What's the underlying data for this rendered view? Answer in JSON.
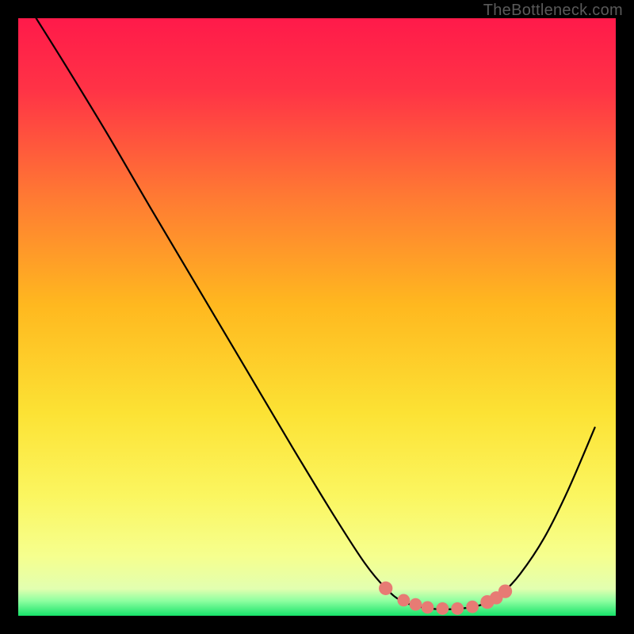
{
  "watermark": "TheBottleneck.com",
  "chart_data": {
    "type": "line",
    "title": "",
    "xlabel": "",
    "ylabel": "",
    "xlim": [
      0,
      100
    ],
    "ylim": [
      0,
      100
    ],
    "gradient_stops": [
      {
        "offset": 0,
        "color": "#ff1a4a"
      },
      {
        "offset": 0.12,
        "color": "#ff3346"
      },
      {
        "offset": 0.3,
        "color": "#ff7a33"
      },
      {
        "offset": 0.48,
        "color": "#ffb81f"
      },
      {
        "offset": 0.66,
        "color": "#fce234"
      },
      {
        "offset": 0.8,
        "color": "#fbf660"
      },
      {
        "offset": 0.9,
        "color": "#f6ff8e"
      },
      {
        "offset": 0.955,
        "color": "#e2ffb0"
      },
      {
        "offset": 0.975,
        "color": "#8effa0"
      },
      {
        "offset": 1.0,
        "color": "#17e36a"
      }
    ],
    "series": [
      {
        "name": "curve",
        "points": [
          {
            "x": 3.0,
            "y": 100.0
          },
          {
            "x": 8.0,
            "y": 92.0
          },
          {
            "x": 15.0,
            "y": 80.5
          },
          {
            "x": 22.0,
            "y": 68.5
          },
          {
            "x": 30.0,
            "y": 55.0
          },
          {
            "x": 38.0,
            "y": 41.5
          },
          {
            "x": 46.0,
            "y": 28.0
          },
          {
            "x": 53.0,
            "y": 16.5
          },
          {
            "x": 58.0,
            "y": 8.8
          },
          {
            "x": 61.5,
            "y": 4.6
          },
          {
            "x": 64.5,
            "y": 2.3
          },
          {
            "x": 69.0,
            "y": 1.2
          },
          {
            "x": 74.0,
            "y": 1.2
          },
          {
            "x": 78.0,
            "y": 2.0
          },
          {
            "x": 81.0,
            "y": 3.8
          },
          {
            "x": 84.0,
            "y": 7.0
          },
          {
            "x": 88.0,
            "y": 13.0
          },
          {
            "x": 92.0,
            "y": 21.0
          },
          {
            "x": 96.5,
            "y": 31.5
          }
        ]
      }
    ],
    "markers": [
      {
        "x": 61.5,
        "y": 4.6,
        "r": 1.1
      },
      {
        "x": 64.5,
        "y": 2.6,
        "r": 0.9
      },
      {
        "x": 66.5,
        "y": 1.9,
        "r": 0.9
      },
      {
        "x": 68.5,
        "y": 1.4,
        "r": 0.9
      },
      {
        "x": 71.0,
        "y": 1.2,
        "r": 0.9
      },
      {
        "x": 73.5,
        "y": 1.2,
        "r": 0.9
      },
      {
        "x": 76.0,
        "y": 1.5,
        "r": 0.9
      },
      {
        "x": 78.5,
        "y": 2.3,
        "r": 1.1
      },
      {
        "x": 80.0,
        "y": 3.0,
        "r": 1.0
      },
      {
        "x": 81.5,
        "y": 4.1,
        "r": 1.1
      }
    ],
    "marker_color": "#e77b74",
    "curve_color": "#000000",
    "curve_width": 2.2
  }
}
